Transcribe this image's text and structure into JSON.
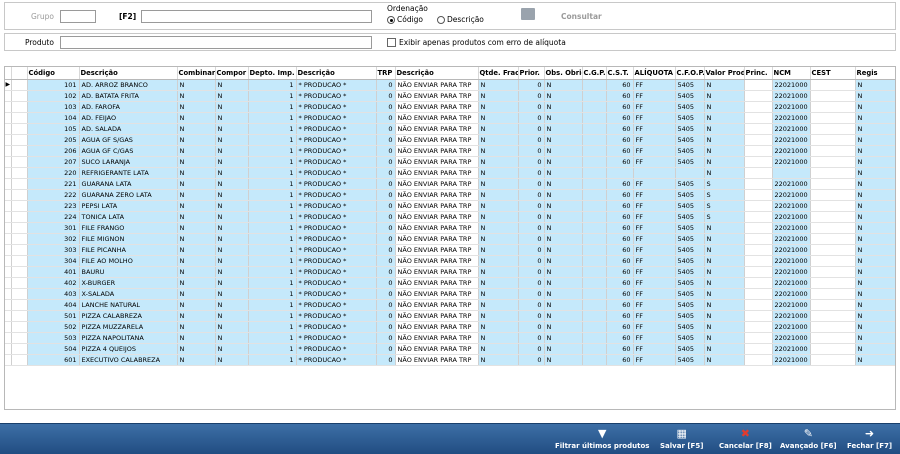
{
  "filters": {
    "grupo_label": "Grupo",
    "f2_label": "[F2]",
    "produto_label": "Produto",
    "ordenacao_label": "Ordenação",
    "ordenacao_codigo": "Código",
    "ordenacao_descricao": "Descrição",
    "consultar_label": "Consultar",
    "exibir_label": "Exibir apenas produtos com erro de alíquota"
  },
  "table": {
    "columns": [
      "Código",
      "Descrição",
      "Combinar",
      "Compor",
      "Depto. Imp.",
      "Descrição",
      "TRP",
      "Descrição",
      "Qtde. Frac.",
      "Prior.",
      "Obs. Obrig.",
      "C.G.P.",
      "C.S.T.",
      "ALÍQUOTA",
      "C.F.O.P.",
      "Valor Prod.",
      "Princ.",
      "NCM",
      "CEST",
      "Regis"
    ],
    "rows": [
      [
        "101",
        "AD. ARROZ BRANCO",
        "N",
        "N",
        "1",
        "* PRODUCAO *",
        "0",
        "NÃO ENVIAR PARA TRP",
        "N",
        "0",
        "N",
        "",
        "60",
        "FF",
        "5405",
        "N",
        "",
        "22021000",
        "",
        "N"
      ],
      [
        "102",
        "AD. BATATA FRITA",
        "N",
        "N",
        "1",
        "* PRODUCAO *",
        "0",
        "NÃO ENVIAR PARA TRP",
        "N",
        "0",
        "N",
        "",
        "60",
        "FF",
        "5405",
        "N",
        "",
        "22021000",
        "",
        "N"
      ],
      [
        "103",
        "AD. FAROFA",
        "N",
        "N",
        "1",
        "* PRODUCAO *",
        "0",
        "NÃO ENVIAR PARA TRP",
        "N",
        "0",
        "N",
        "",
        "60",
        "FF",
        "5405",
        "N",
        "",
        "22021000",
        "",
        "N"
      ],
      [
        "104",
        "AD. FEIJAO",
        "N",
        "N",
        "1",
        "* PRODUCAO *",
        "0",
        "NÃO ENVIAR PARA TRP",
        "N",
        "0",
        "N",
        "",
        "60",
        "FF",
        "5405",
        "N",
        "",
        "22021000",
        "",
        "N"
      ],
      [
        "105",
        "AD. SALADA",
        "N",
        "N",
        "1",
        "* PRODUCAO *",
        "0",
        "NÃO ENVIAR PARA TRP",
        "N",
        "0",
        "N",
        "",
        "60",
        "FF",
        "5405",
        "N",
        "",
        "22021000",
        "",
        "N"
      ],
      [
        "205",
        "AGUA GF S/GAS",
        "N",
        "N",
        "1",
        "* PRODUCAO *",
        "0",
        "NÃO ENVIAR PARA TRP",
        "N",
        "0",
        "N",
        "",
        "60",
        "FF",
        "5405",
        "N",
        "",
        "22021000",
        "",
        "N"
      ],
      [
        "206",
        "AGUA GF C/GAS",
        "N",
        "N",
        "1",
        "* PRODUCAO *",
        "0",
        "NÃO ENVIAR PARA TRP",
        "N",
        "0",
        "N",
        "",
        "60",
        "FF",
        "5405",
        "N",
        "",
        "22021000",
        "",
        "N"
      ],
      [
        "207",
        "SUCO LARANJA",
        "N",
        "N",
        "1",
        "* PRODUCAO *",
        "0",
        "NÃO ENVIAR PARA TRP",
        "N",
        "0",
        "N",
        "",
        "60",
        "FF",
        "5405",
        "N",
        "",
        "22021000",
        "",
        "N"
      ],
      [
        "220",
        "REFRIGERANTE LATA",
        "N",
        "N",
        "1",
        "* PRODUCAO *",
        "0",
        "NÃO ENVIAR PARA TRP",
        "N",
        "0",
        "N",
        "",
        "",
        "",
        "",
        "N",
        "",
        "",
        "",
        "N"
      ],
      [
        "221",
        "GUARANA LATA",
        "N",
        "N",
        "1",
        "* PRODUCAO *",
        "0",
        "NÃO ENVIAR PARA TRP",
        "N",
        "0",
        "N",
        "",
        "60",
        "FF",
        "5405",
        "S",
        "",
        "22021000",
        "",
        "N"
      ],
      [
        "222",
        "GUARANA ZERO LATA",
        "N",
        "N",
        "1",
        "* PRODUCAO *",
        "0",
        "NÃO ENVIAR PARA TRP",
        "N",
        "0",
        "N",
        "",
        "60",
        "FF",
        "5405",
        "S",
        "",
        "22021000",
        "",
        "N"
      ],
      [
        "223",
        "PEPSI LATA",
        "N",
        "N",
        "1",
        "* PRODUCAO *",
        "0",
        "NÃO ENVIAR PARA TRP",
        "N",
        "0",
        "N",
        "",
        "60",
        "FF",
        "5405",
        "S",
        "",
        "22021000",
        "",
        "N"
      ],
      [
        "224",
        "TONICA LATA",
        "N",
        "N",
        "1",
        "* PRODUCAO *",
        "0",
        "NÃO ENVIAR PARA TRP",
        "N",
        "0",
        "N",
        "",
        "60",
        "FF",
        "5405",
        "S",
        "",
        "22021000",
        "",
        "N"
      ],
      [
        "301",
        "FILE FRANGO",
        "N",
        "N",
        "1",
        "* PRODUCAO *",
        "0",
        "NÃO ENVIAR PARA TRP",
        "N",
        "0",
        "N",
        "",
        "60",
        "FF",
        "5405",
        "N",
        "",
        "22021000",
        "",
        "N"
      ],
      [
        "302",
        "FILE MIGNON",
        "N",
        "N",
        "1",
        "* PRODUCAO *",
        "0",
        "NÃO ENVIAR PARA TRP",
        "N",
        "0",
        "N",
        "",
        "60",
        "FF",
        "5405",
        "N",
        "",
        "22021000",
        "",
        "N"
      ],
      [
        "303",
        "FILE PICANHA",
        "N",
        "N",
        "1",
        "* PRODUCAO *",
        "0",
        "NÃO ENVIAR PARA TRP",
        "N",
        "0",
        "N",
        "",
        "60",
        "FF",
        "5405",
        "N",
        "",
        "22021000",
        "",
        "N"
      ],
      [
        "304",
        "FILE AO MOLHO",
        "N",
        "N",
        "1",
        "* PRODUCAO *",
        "0",
        "NÃO ENVIAR PARA TRP",
        "N",
        "0",
        "N",
        "",
        "60",
        "FF",
        "5405",
        "N",
        "",
        "22021000",
        "",
        "N"
      ],
      [
        "401",
        "BAURU",
        "N",
        "N",
        "1",
        "* PRODUCAO *",
        "0",
        "NÃO ENVIAR PARA TRP",
        "N",
        "0",
        "N",
        "",
        "60",
        "FF",
        "5405",
        "N",
        "",
        "22021000",
        "",
        "N"
      ],
      [
        "402",
        "X-BURGER",
        "N",
        "N",
        "1",
        "* PRODUCAO *",
        "0",
        "NÃO ENVIAR PARA TRP",
        "N",
        "0",
        "N",
        "",
        "60",
        "FF",
        "5405",
        "N",
        "",
        "22021000",
        "",
        "N"
      ],
      [
        "403",
        "X-SALADA",
        "N",
        "N",
        "1",
        "* PRODUCAO *",
        "0",
        "NÃO ENVIAR PARA TRP",
        "N",
        "0",
        "N",
        "",
        "60",
        "FF",
        "5405",
        "N",
        "",
        "22021000",
        "",
        "N"
      ],
      [
        "404",
        "LANCHE NATURAL",
        "N",
        "N",
        "1",
        "* PRODUCAO *",
        "0",
        "NÃO ENVIAR PARA TRP",
        "N",
        "0",
        "N",
        "",
        "60",
        "FF",
        "5405",
        "N",
        "",
        "22021000",
        "",
        "N"
      ],
      [
        "501",
        "PIZZA CALABREZA",
        "N",
        "N",
        "1",
        "* PRODUCAO *",
        "0",
        "NÃO ENVIAR PARA TRP",
        "N",
        "0",
        "N",
        "",
        "60",
        "FF",
        "5405",
        "N",
        "",
        "22021000",
        "",
        "N"
      ],
      [
        "502",
        "PIZZA MUZZARELA",
        "N",
        "N",
        "1",
        "* PRODUCAO *",
        "0",
        "NÃO ENVIAR PARA TRP",
        "N",
        "0",
        "N",
        "",
        "60",
        "FF",
        "5405",
        "N",
        "",
        "22021000",
        "",
        "N"
      ],
      [
        "503",
        "PIZZA NAPOLITANA",
        "N",
        "N",
        "1",
        "* PRODUCAO *",
        "0",
        "NÃO ENVIAR PARA TRP",
        "N",
        "0",
        "N",
        "",
        "60",
        "FF",
        "5405",
        "N",
        "",
        "22021000",
        "",
        "N"
      ],
      [
        "504",
        "PIZZA 4 QUEIJOS",
        "N",
        "N",
        "1",
        "* PRODUCAO *",
        "0",
        "NÃO ENVIAR PARA TRP",
        "N",
        "0",
        "N",
        "",
        "60",
        "FF",
        "5405",
        "N",
        "",
        "22021000",
        "",
        "N"
      ],
      [
        "601",
        "EXECUTIVO CALABREZA",
        "N",
        "N",
        "1",
        "* PRODUCAO *",
        "0",
        "NÃO ENVIAR PARA TRP",
        "N",
        "0",
        "N",
        "",
        "60",
        "FF",
        "5405",
        "N",
        "",
        "22021000",
        "",
        "N"
      ]
    ]
  },
  "footer": {
    "filtrar": "Filtrar últimos produtos",
    "salvar": "Salvar [F5]",
    "cancelar": "Cancelar [F8]",
    "avancado": "Avançado [F6]",
    "fechar": "Fechar [F7]"
  }
}
